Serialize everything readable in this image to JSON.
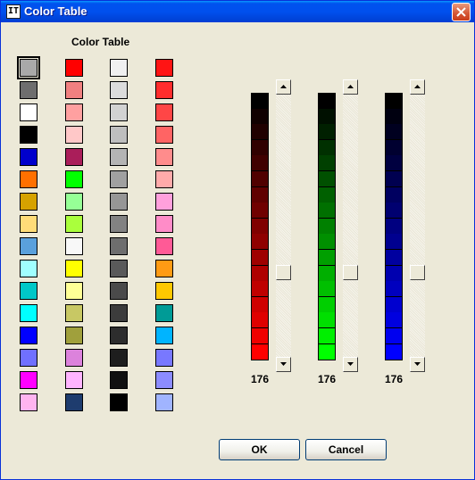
{
  "window": {
    "title": "Color Table",
    "icon_label": "IT"
  },
  "palette": {
    "heading": "Color Table",
    "columns": [
      [
        "#a9a9a9",
        "#6e6e6e",
        "#ffffff",
        "#000000",
        "#0000cc",
        "#ff7000",
        "#d6a200",
        "#ffdc78",
        "#5aa0dc",
        "#a0ffff",
        "#00c8c8",
        "#00ffff",
        "#0000ff",
        "#7070ff",
        "#ff00ff",
        "#ffb4f0"
      ],
      [
        "#ff0000",
        "#f08080",
        "#ffa0a0",
        "#ffc8c8",
        "#aa1e5a",
        "#00ff00",
        "#96ff96",
        "#aaff3c",
        "#f8f8f8",
        "#ffff00",
        "#ffff96",
        "#c8c864",
        "#a0a03c",
        "#dc82dc",
        "#ffb4ff",
        "#1e3c6e"
      ],
      [
        "#f0f0f0",
        "#dcdcdc",
        "#d2d2d2",
        "#bebebe",
        "#b4b4b4",
        "#a0a0a0",
        "#969696",
        "#828282",
        "#6e6e6e",
        "#5a5a5a",
        "#4a4a4a",
        "#3c3c3c",
        "#2d2d2d",
        "#1e1e1e",
        "#101010",
        "#000000"
      ],
      [
        "#ff1414",
        "#ff2d2d",
        "#ff4646",
        "#ff6464",
        "#ff8c8c",
        "#ffaaaa",
        "#ffa0dc",
        "#ff8cc8",
        "#ff5a96",
        "#ff9b14",
        "#ffc800",
        "#009b96",
        "#00b4ff",
        "#7878ff",
        "#8c8cff",
        "#a0b4ff"
      ]
    ],
    "selected": [
      0,
      0
    ]
  },
  "channels": [
    {
      "name": "red",
      "color": "#ff0000",
      "value": "176",
      "level": 0.69
    },
    {
      "name": "green",
      "color": "#00ff00",
      "value": "176",
      "level": 0.69
    },
    {
      "name": "blue",
      "color": "#0000ff",
      "value": "176",
      "level": 0.69
    }
  ],
  "buttons": {
    "ok": "OK",
    "cancel": "Cancel"
  }
}
